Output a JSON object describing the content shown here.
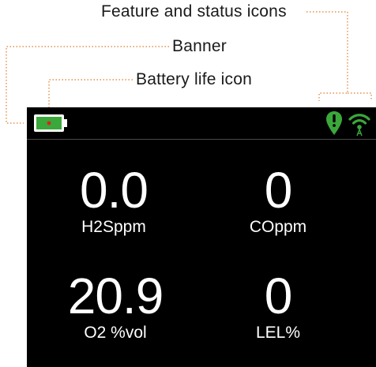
{
  "callouts": {
    "feature_status": "Feature and status icons",
    "banner": "Banner",
    "battery": "Battery life icon"
  },
  "banner": {
    "battery_icon": "battery-icon",
    "status_icons": [
      "location-alert-icon",
      "wireless-signal-icon"
    ],
    "colors": {
      "battery_fill": "#3aa83a",
      "battery_dot": "#e02020",
      "status_green": "#3aa83a"
    }
  },
  "readings": [
    {
      "value": "0.0",
      "unit": "H2Sppm"
    },
    {
      "value": "0",
      "unit": "COppm"
    },
    {
      "value": "20.9",
      "unit": "O2 %vol"
    },
    {
      "value": "0",
      "unit": "LEL%"
    }
  ],
  "colors": {
    "screen_background": "#000000",
    "reading_text": "#ffffff",
    "leader_line": "#e07a28"
  }
}
